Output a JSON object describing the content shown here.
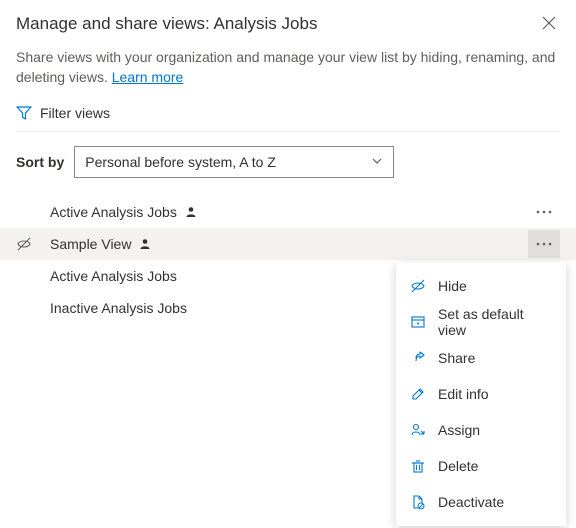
{
  "header": {
    "title": "Manage and share views: Analysis Jobs",
    "close_label": "✕"
  },
  "description": {
    "text": "Share views with your organization and manage your view list by hiding, renaming, and deleting views. ",
    "link": "Learn more"
  },
  "filter": {
    "label": "Filter views"
  },
  "sort": {
    "label": "Sort by",
    "selected": "Personal before system, A to Z"
  },
  "rows": [
    {
      "label": "Active Analysis Jobs",
      "personal": true,
      "hidden": false,
      "selected": false,
      "showMore": true
    },
    {
      "label": "Sample View",
      "personal": true,
      "hidden": true,
      "selected": true,
      "showMore": true
    },
    {
      "label": "Active Analysis Jobs",
      "personal": false,
      "hidden": false,
      "selected": false,
      "showMore": false
    },
    {
      "label": "Inactive Analysis Jobs",
      "personal": false,
      "hidden": false,
      "selected": false,
      "showMore": false
    }
  ],
  "menu": {
    "items": [
      {
        "icon": "hide",
        "label": "Hide"
      },
      {
        "icon": "default",
        "label": "Set as default view"
      },
      {
        "icon": "share",
        "label": "Share"
      },
      {
        "icon": "edit",
        "label": "Edit info"
      },
      {
        "icon": "assign",
        "label": "Assign"
      },
      {
        "icon": "delete",
        "label": "Delete"
      },
      {
        "icon": "deactivate",
        "label": "Deactivate"
      }
    ]
  }
}
